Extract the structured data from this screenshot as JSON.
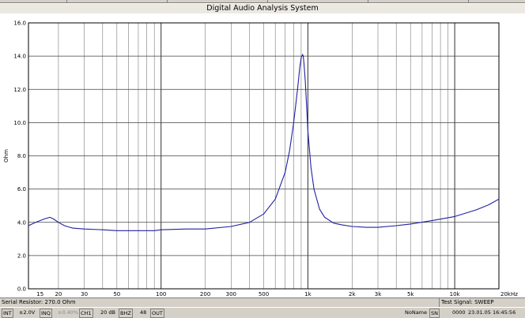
{
  "window": {
    "title": "Digital Audio Analysis System"
  },
  "chart_data": {
    "type": "line",
    "title": "",
    "xlabel": "",
    "ylabel": "Ohm",
    "x_scale": "log",
    "xlim": [
      12.5,
      20000
    ],
    "ylim": [
      0,
      16
    ],
    "grid": true,
    "y_ticks": [
      "0.0",
      "2.0",
      "4.0",
      "6.0",
      "8.0",
      "10.0",
      "12.0",
      "14.0",
      "16.0"
    ],
    "x_ticks": [
      {
        "value": 15,
        "label": "15"
      },
      {
        "value": 20,
        "label": "20"
      },
      {
        "value": 30,
        "label": "30"
      },
      {
        "value": 50,
        "label": "50"
      },
      {
        "value": 100,
        "label": "100"
      },
      {
        "value": 200,
        "label": "200"
      },
      {
        "value": 300,
        "label": "300"
      },
      {
        "value": 500,
        "label": "500"
      },
      {
        "value": 1000,
        "label": "1k"
      },
      {
        "value": 2000,
        "label": "2k"
      },
      {
        "value": 3000,
        "label": "3k"
      },
      {
        "value": 5000,
        "label": "5k"
      },
      {
        "value": 10000,
        "label": "10k"
      },
      {
        "value": 20000,
        "label": "20kHz"
      }
    ],
    "series": [
      {
        "color": "#2020a0",
        "x": [
          12.5,
          14,
          16,
          17.5,
          18.5,
          20,
          22,
          25,
          30,
          40,
          50,
          70,
          90,
          100,
          150,
          200,
          300,
          400,
          500,
          600,
          700,
          750,
          800,
          850,
          880,
          900,
          920,
          930,
          940,
          960,
          980,
          1000,
          1050,
          1100,
          1200,
          1300,
          1500,
          1700,
          2000,
          2500,
          3000,
          4000,
          5000,
          7000,
          10000,
          14000,
          17000,
          20000
        ],
        "y": [
          3.8,
          4.0,
          4.2,
          4.3,
          4.2,
          4.0,
          3.8,
          3.65,
          3.6,
          3.55,
          3.5,
          3.5,
          3.5,
          3.55,
          3.6,
          3.6,
          3.75,
          4.0,
          4.5,
          5.4,
          7.0,
          8.3,
          10.0,
          12.0,
          13.3,
          13.9,
          14.1,
          14.0,
          13.6,
          12.5,
          11.0,
          9.5,
          7.3,
          6.0,
          4.8,
          4.3,
          3.95,
          3.85,
          3.75,
          3.7,
          3.7,
          3.8,
          3.9,
          4.1,
          4.35,
          4.75,
          5.05,
          5.4
        ]
      }
    ]
  },
  "info": {
    "serial_resistor": "Serial Resistor: 270.0 Ohm",
    "test_signal": "Test Signal: SWEEP"
  },
  "status": {
    "int": "INT",
    "voltage": "±2.0V",
    "inq": "INQ",
    "inq_val": "±0.40%",
    "ch": "CH1",
    "db": "20 dB",
    "bhz": "BHZ",
    "count": "48",
    "out": "OUT",
    "noname": "NoName",
    "sn": "SN",
    "num": "0000",
    "datetime": "23.01.05  16:45:56"
  }
}
